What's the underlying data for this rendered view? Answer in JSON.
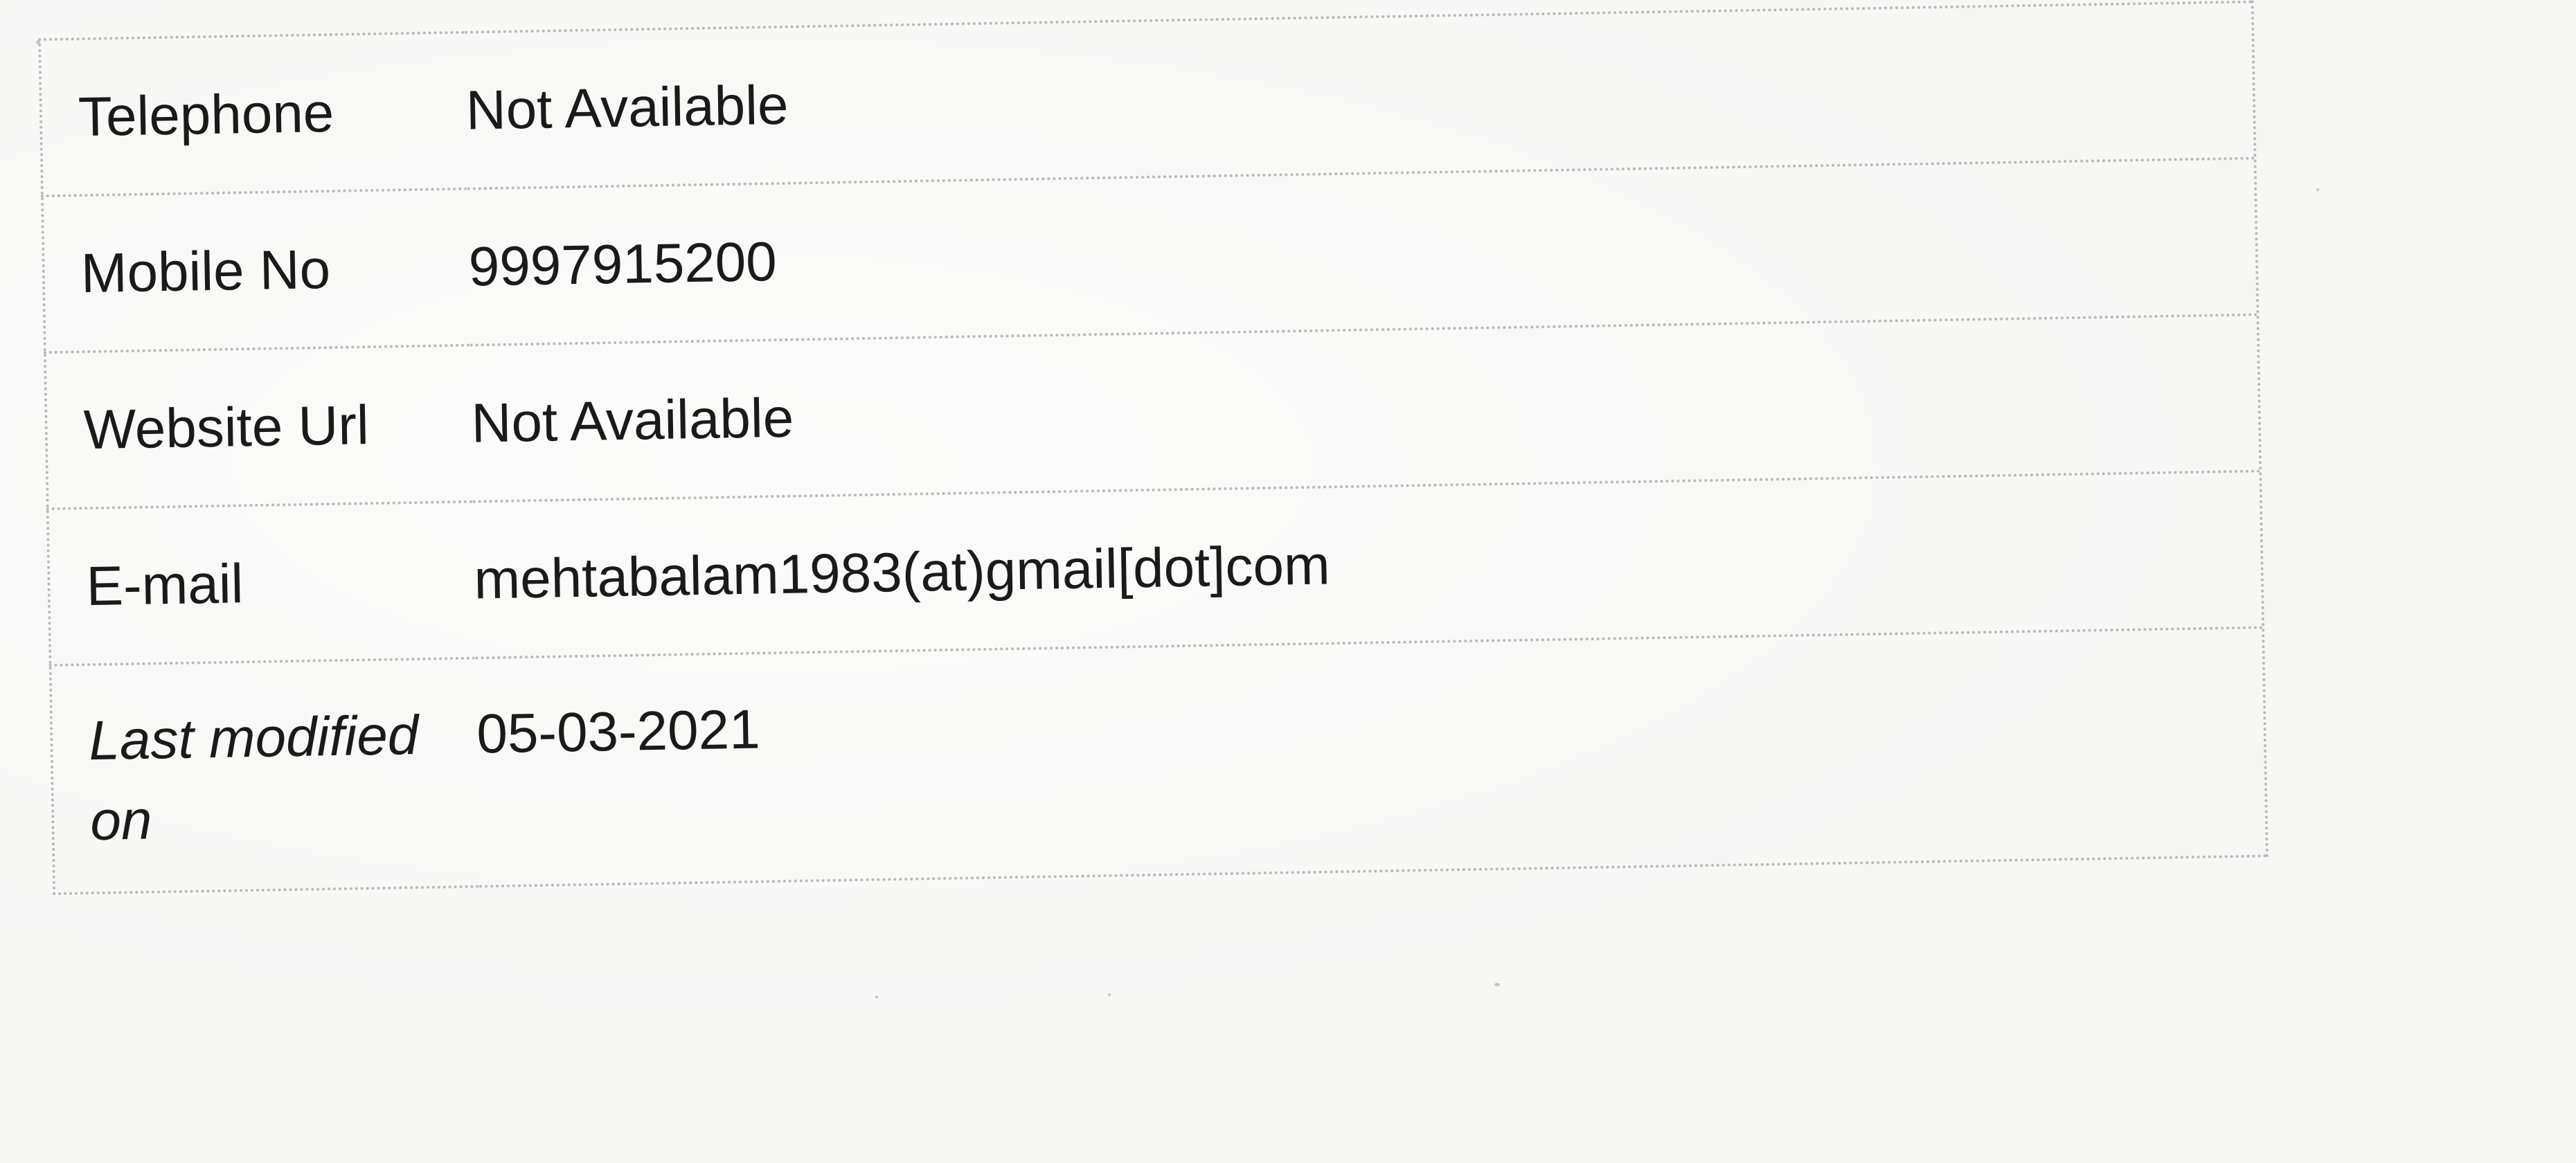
{
  "contact_table": {
    "rows": [
      {
        "label": "Telephone",
        "value": "Not Available"
      },
      {
        "label": "Mobile No",
        "value": "9997915200"
      },
      {
        "label": "Website Url",
        "value": "Not Available"
      },
      {
        "label": "E-mail",
        "value": "mehtabalam1983(at)gmail[dot]com"
      },
      {
        "label": "Last modified on",
        "value": "05-03-2021"
      }
    ]
  }
}
